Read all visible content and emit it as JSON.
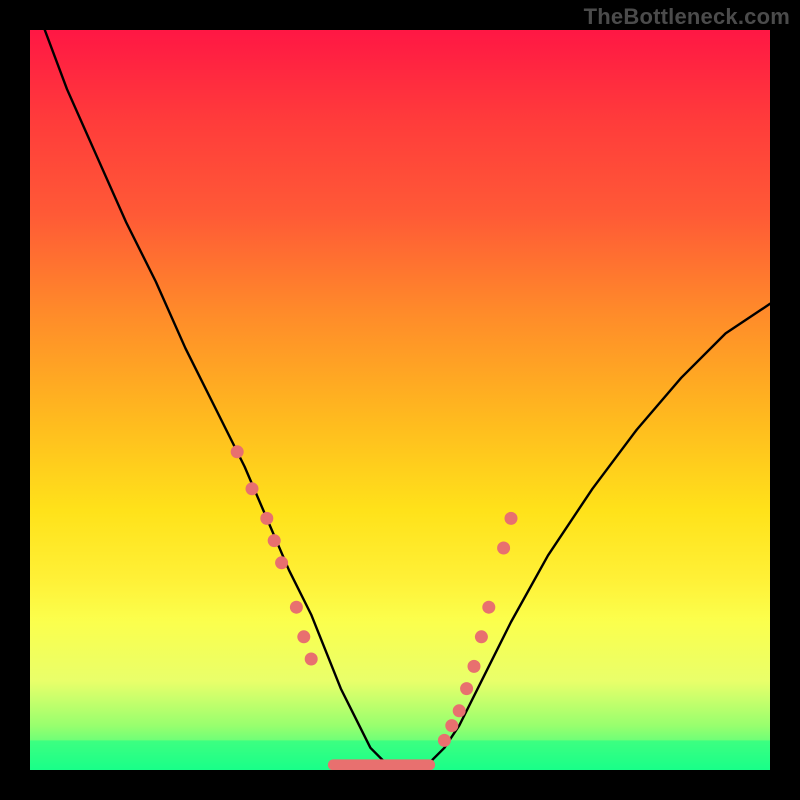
{
  "watermark": "TheBottleneck.com",
  "chart_data": {
    "type": "line",
    "title": "",
    "xlabel": "",
    "ylabel": "",
    "xlim": [
      0,
      100
    ],
    "ylim": [
      0,
      100
    ],
    "grid": false,
    "legend": false,
    "series": [
      {
        "name": "curve",
        "color": "#000000",
        "x": [
          2,
          5,
          9,
          13,
          17,
          21,
          25,
          29,
          32,
          35,
          38,
          40,
          42,
          44,
          46,
          48,
          50,
          52,
          54,
          56,
          58,
          61,
          65,
          70,
          76,
          82,
          88,
          94,
          100
        ],
        "values": [
          100,
          92,
          83,
          74,
          66,
          57,
          49,
          41,
          34,
          27,
          21,
          16,
          11,
          7,
          3,
          1,
          0.5,
          0.5,
          1,
          3,
          6,
          12,
          20,
          29,
          38,
          46,
          53,
          59,
          63
        ]
      }
    ],
    "markers_left": {
      "name": "left-dots",
      "color": "#e8706f",
      "x": [
        28,
        30,
        32,
        33,
        34,
        36,
        37,
        38
      ],
      "values": [
        43,
        38,
        34,
        31,
        28,
        22,
        18,
        15
      ]
    },
    "markers_right": {
      "name": "right-dots",
      "color": "#e8706f",
      "x": [
        56,
        57,
        58,
        59,
        60,
        61,
        62,
        64,
        65
      ],
      "values": [
        4,
        6,
        8,
        11,
        14,
        18,
        22,
        30,
        34
      ]
    },
    "flat_segment": {
      "name": "bottom-bar",
      "color": "#e8706f",
      "x_start": 41,
      "x_end": 54,
      "value": 0.7
    },
    "green_band": {
      "name": "green-band",
      "color": "#14ff88",
      "y_start": 0,
      "y_end": 4
    }
  }
}
